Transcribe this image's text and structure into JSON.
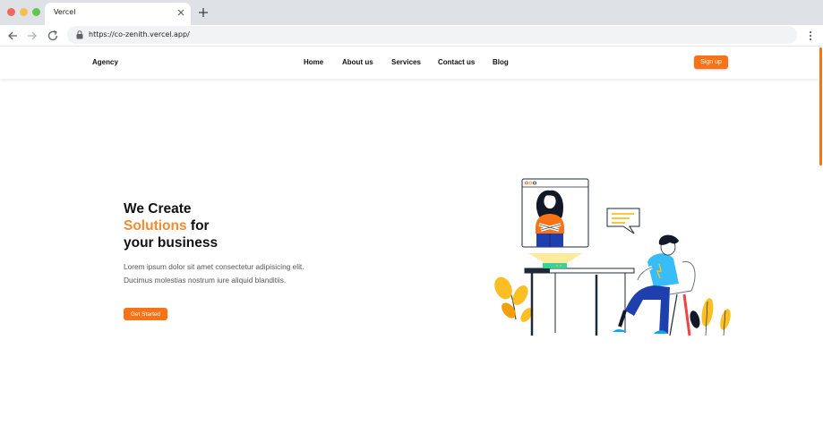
{
  "browser": {
    "tab_title": "Vercel",
    "url": "https://co-zenith.vercel.app/"
  },
  "nav": {
    "brand": "Agency",
    "links": [
      "Home",
      "About us",
      "Services",
      "Contact us",
      "Blog"
    ],
    "signup_label": "Sign up"
  },
  "hero": {
    "title_line1": "We Create",
    "title_accent": "Solutions",
    "title_line2_rest": " for",
    "title_line3": "your business",
    "description": "Lorem ipsum dolor sit amet consectetur adipisicing elit. Ducimus molestias nostrum iure aliquid blanditiis.",
    "cta_label": "Get Started"
  },
  "colors": {
    "accent": "#f97316",
    "title_accent": "#f28c2e",
    "chrome": "#dee1e6"
  },
  "icons": [
    "close-icon",
    "plus-icon",
    "back-arrow-icon",
    "forward-arrow-icon",
    "reload-icon",
    "lock-icon",
    "menu-dots-icon"
  ]
}
